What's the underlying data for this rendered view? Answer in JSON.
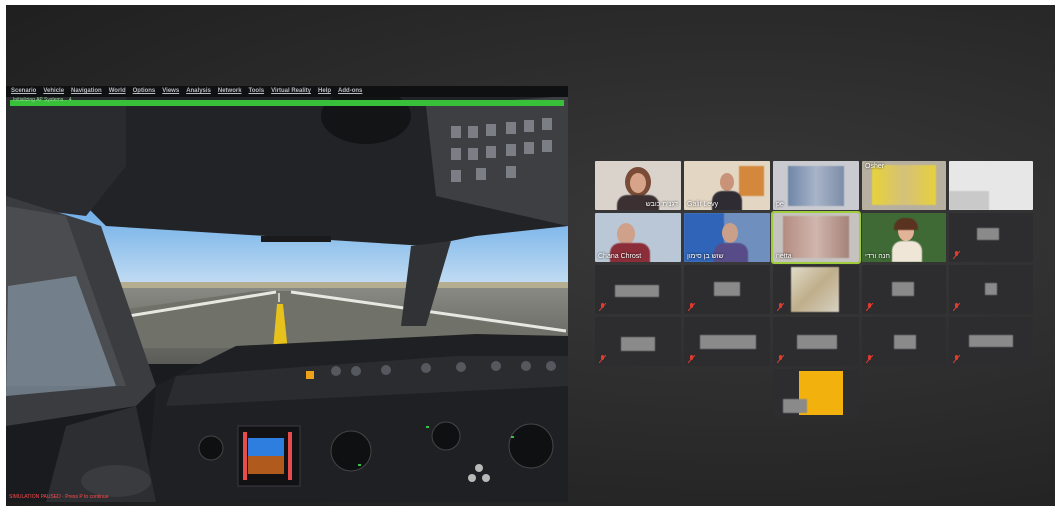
{
  "simulator": {
    "menu": [
      "Scenario",
      "Vehicle",
      "Navigation",
      "World",
      "Options",
      "Views",
      "Analysis",
      "Network",
      "Tools",
      "Virtual Reality",
      "Help",
      "Add-ons"
    ],
    "loading_text": "Initializing AP Systems... 4",
    "loading_progress": 1.0,
    "status_message": "SIMULATION PAUSED · Press P to continue"
  },
  "gallery": {
    "participants": [
      {
        "name": "דגנית כובש",
        "video": true
      },
      {
        "name": "Galit Levy",
        "video": true
      },
      {
        "name": "pe",
        "video": true
      },
      {
        "name": "Osher",
        "video": true
      },
      {
        "name": "",
        "video": true
      },
      {
        "name": "Chana Chrost",
        "video": true
      },
      {
        "name": "שוש בן סימון",
        "video": true
      },
      {
        "name": "netta",
        "video": true
      },
      {
        "name": "חנה ורדי",
        "video": true
      },
      {
        "name": "",
        "video": false
      },
      {
        "name": "",
        "video": false
      },
      {
        "name": "",
        "video": false
      },
      {
        "name": "",
        "video": false
      },
      {
        "name": "",
        "video": false
      },
      {
        "name": "",
        "video": false
      },
      {
        "name": "",
        "video": false
      },
      {
        "name": "",
        "video": false
      },
      {
        "name": "",
        "video": false
      },
      {
        "name": "",
        "video": false
      },
      {
        "name": "",
        "video": false
      },
      {
        "name": "",
        "video": false
      }
    ],
    "colors": {
      "active_speaker": "#9fcd3e",
      "muted_icon": "#e23b2e",
      "tile_bg": "#2d2d2f"
    }
  }
}
